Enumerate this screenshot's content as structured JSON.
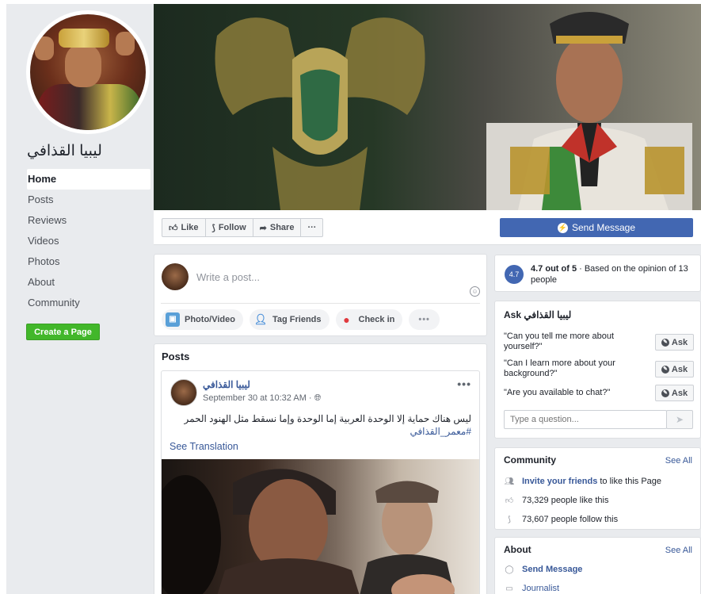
{
  "page": {
    "name": "ليبيا القذافي"
  },
  "sidebar": {
    "items": [
      {
        "label": "Home",
        "active": true
      },
      {
        "label": "Posts"
      },
      {
        "label": "Reviews"
      },
      {
        "label": "Videos"
      },
      {
        "label": "Photos"
      },
      {
        "label": "About"
      },
      {
        "label": "Community"
      }
    ],
    "create_page": "Create a Page"
  },
  "actions": {
    "like": "Like",
    "follow": "Follow",
    "share": "Share",
    "more": "···",
    "send_message": "Send Message"
  },
  "composer": {
    "placeholder": "Write a post...",
    "photo_video": "Photo/Video",
    "tag_friends": "Tag Friends",
    "check_in": "Check in",
    "more": "•••"
  },
  "posts": {
    "title": "Posts",
    "items": [
      {
        "author": "ليبيا القذافي",
        "meta": "September 30 at 10:32 AM · ",
        "text": "ليس هناك حماية إلا الوحدة العربية إما الوحدة وإما نسقط مثل الهنود الحمر",
        "hashtag": "#معمر_القذافي",
        "see_translation": "See Translation",
        "menu": "•••"
      }
    ]
  },
  "rating": {
    "badge": "4.7",
    "score": "4.7 out of 5",
    "text": " · Based on the opinion of 13 people"
  },
  "ask": {
    "title": "Ask ليبيا القذافي",
    "questions": [
      {
        "q": "\"Can you tell me more about yourself?\"",
        "btn": "Ask"
      },
      {
        "q": "\"Can I learn more about your background?\"",
        "btn": "Ask"
      },
      {
        "q": "\"Are you available to chat?\"",
        "btn": "Ask"
      }
    ],
    "placeholder": "Type a question..."
  },
  "community": {
    "title": "Community",
    "see_all": "See All",
    "invite_link": "Invite your friends",
    "invite_rest": "to like this Page",
    "likes": "73,329 people like this",
    "follows": "73,607 people follow this"
  },
  "about": {
    "title": "About",
    "see_all": "See All",
    "send_message": "Send Message",
    "category": "Journalist"
  },
  "colors": {
    "brand": "#4267b2",
    "link": "#385898",
    "create_green": "#42b72a"
  }
}
